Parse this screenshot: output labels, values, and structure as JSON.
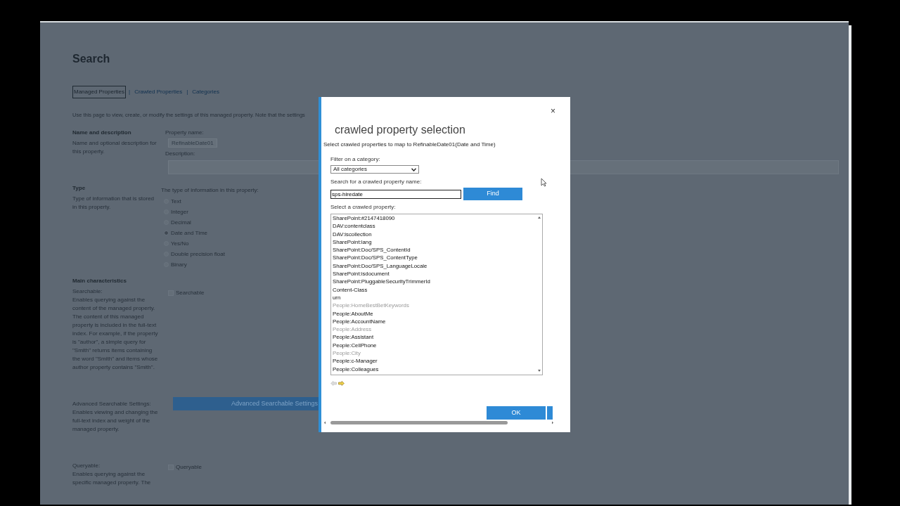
{
  "page": {
    "title": "Search",
    "nav_links": [
      {
        "label": "Managed Properties",
        "selected": true
      },
      {
        "label": "Crawled Properties",
        "selected": false
      },
      {
        "label": "Categories",
        "selected": false
      }
    ],
    "nav_separators": [
      "|",
      "|"
    ],
    "intro": "Use this page to view, create, or modify the settings of this managed property. Note that the settings",
    "name_section": {
      "heading": "Name and description",
      "description": "Name and optional description for this property.",
      "property_name_label": "Property name:",
      "property_name_value": "RefinableDate01",
      "description_label": "Description:"
    },
    "type_section": {
      "heading": "Type",
      "description": "Type of information that is stored in this property.",
      "prompt": "The type of information in this property:",
      "options": [
        {
          "label": "Text",
          "selected": false
        },
        {
          "label": "Integer",
          "selected": false
        },
        {
          "label": "Decimal",
          "selected": false
        },
        {
          "label": "Date and Time",
          "selected": true
        },
        {
          "label": "Yes/No",
          "selected": false
        },
        {
          "label": "Double precision float",
          "selected": false
        },
        {
          "label": "Binary",
          "selected": false
        }
      ]
    },
    "main_characteristics": {
      "heading": "Main characteristics",
      "items": [
        {
          "title": "Searchable:",
          "text": "Enables querying against the content of the managed property. The content of this managed property is included in the full-text index. For example, if the property is \"author\", a simple query for \"Smith\" returns items containing the word \"Smith\" and items whose author property contains \"Smith\".",
          "control": {
            "kind": "checkbox",
            "label": "Searchable",
            "checked": false
          }
        },
        {
          "title": "Advanced Searchable Settings:",
          "text": "Enables viewing and changing the full-text index and weight of the managed property.",
          "control": {
            "kind": "button",
            "label": "Advanced Searchable Settings"
          }
        },
        {
          "title": "Queryable:",
          "text": "Enables querying against the specific managed property. The",
          "control": {
            "kind": "checkbox",
            "label": "Queryable",
            "checked": false
          }
        }
      ]
    }
  },
  "dialog": {
    "close": "×",
    "title": "crawled property selection",
    "subtitle": "Select crawled properties to map to RefinableDate01(Date and Time)",
    "filter_label": "Filter on a category:",
    "filter_value": "All categories",
    "search_label": "Search for a crawled property name:",
    "search_value": "sps-hiredate",
    "find_button": "Find",
    "list_label": "Select a crawled property:",
    "properties": [
      {
        "name": "SharePoint:#2147418090",
        "dimmed": false
      },
      {
        "name": "DAV:contentclass",
        "dimmed": false
      },
      {
        "name": "DAV:iscollection",
        "dimmed": false
      },
      {
        "name": "SharePoint:lang",
        "dimmed": false
      },
      {
        "name": "SharePoint:Doc/SPS_ContentId",
        "dimmed": false
      },
      {
        "name": "SharePoint:Doc/SPS_ContentType",
        "dimmed": false
      },
      {
        "name": "SharePoint:Doc/SPS_LanguageLocale",
        "dimmed": false
      },
      {
        "name": "SharePoint:isdocument",
        "dimmed": false
      },
      {
        "name": "SharePoint:PluggableSecurityTrimmerId",
        "dimmed": false
      },
      {
        "name": "Content-Class",
        "dimmed": false
      },
      {
        "name": "urn",
        "dimmed": false
      },
      {
        "name": "People:HomeBestBetKeywords",
        "dimmed": true
      },
      {
        "name": "People:AboutMe",
        "dimmed": false
      },
      {
        "name": "People:AccountName",
        "dimmed": false
      },
      {
        "name": "People:Address",
        "dimmed": true
      },
      {
        "name": "People:Assistant",
        "dimmed": false
      },
      {
        "name": "People:CellPhone",
        "dimmed": false
      },
      {
        "name": "People:City",
        "dimmed": true
      },
      {
        "name": "People:c-Manager",
        "dimmed": false
      },
      {
        "name": "People:Colleagues",
        "dimmed": false
      }
    ],
    "ok_button": "OK"
  }
}
